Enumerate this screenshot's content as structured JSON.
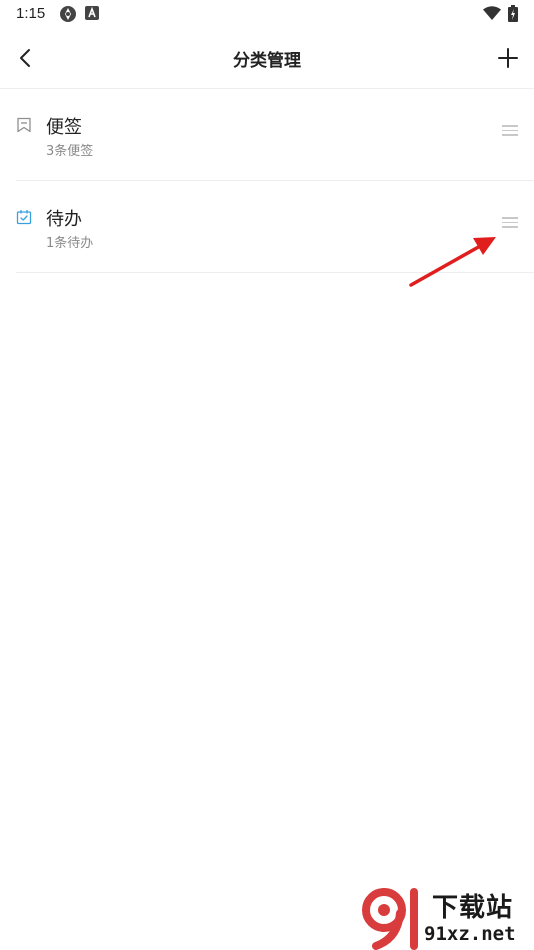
{
  "status_bar": {
    "time": "1:15"
  },
  "header": {
    "title": "分类管理"
  },
  "categories": [
    {
      "name": "便签",
      "count_text": "3条便签",
      "icon": "bookmark-icon"
    },
    {
      "name": "待办",
      "count_text": "1条待办",
      "icon": "calendar-check-icon"
    }
  ],
  "colors": {
    "accent": "#3aa0e0",
    "annotation_arrow": "#e01e1e"
  },
  "watermark": {
    "logo_text": "91",
    "title": "下载站",
    "url": "91xz.net"
  }
}
